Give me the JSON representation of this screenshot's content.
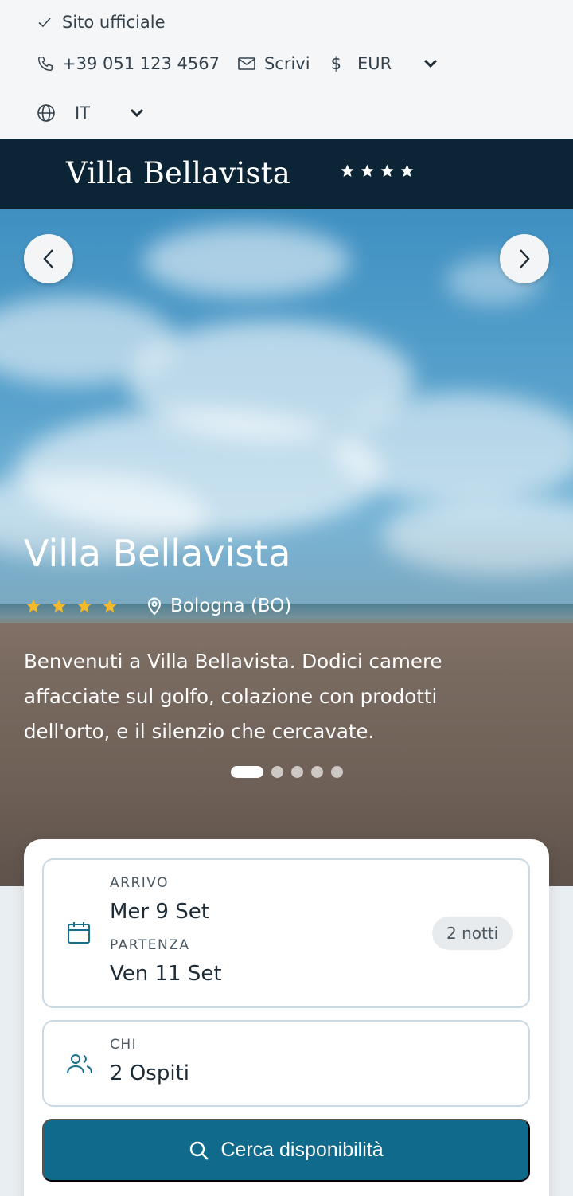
{
  "topbar": {
    "official_label": "Sito ufficiale",
    "phone": "+39 051 123 4567",
    "write_label": "Scrivi",
    "currency_symbol": "$",
    "currency": "EUR",
    "language": "IT"
  },
  "brand": {
    "name": "Villa Bellavista",
    "stars": 4
  },
  "hero": {
    "title": "Villa Bellavista",
    "stars": 4,
    "location": "Bologna (BO)",
    "description": "Benvenuti a Villa Bellavista. Dodici camere affacciate sul golfo, colazione con prodotti dell'orto, e il silenzio che cercavate.",
    "slides_total": 5,
    "active_slide": 1
  },
  "booking": {
    "arrival_label": "ARRIVO",
    "arrival_value": "Mer 9 Set",
    "departure_label": "PARTENZA",
    "departure_value": "Ven 11 Set",
    "nights": "2 notti",
    "guests_label": "CHI",
    "guests_value": "2 Ospiti",
    "search_label": "Cerca disponibilità"
  },
  "colors": {
    "brand_bar": "#0b2436",
    "accent": "#0f6a8c",
    "star": "#f4b829"
  }
}
